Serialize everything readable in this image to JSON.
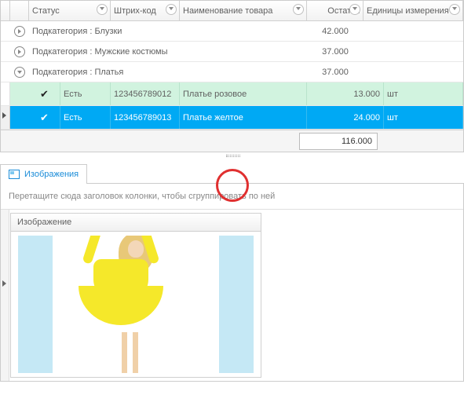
{
  "columns": {
    "status": "Статус",
    "barcode": "Штрих-код",
    "name": "Наименование товара",
    "rest": "Остаток",
    "unit": "Единицы измерения"
  },
  "groups": [
    {
      "label": "Подкатегория : Блузки",
      "rest": "42.000",
      "expanded": false
    },
    {
      "label": "Подкатегория : Мужские костюмы",
      "rest": "37.000",
      "expanded": false
    },
    {
      "label": "Подкатегория : Платья",
      "rest": "37.000",
      "expanded": true
    }
  ],
  "rows": [
    {
      "status": "Есть",
      "barcode": "123456789012",
      "name": "Платье розовое",
      "rest": "13.000",
      "unit": "шт",
      "selected": false
    },
    {
      "status": "Есть",
      "barcode": "123456789013",
      "name": "Платье желтое",
      "rest": "24.000",
      "unit": "шт",
      "selected": true
    }
  ],
  "total": "116.000",
  "tab": "Изображения",
  "group_hint": "Перетащите сюда заголовок колонки, чтобы сгруппировать по ней",
  "image_col": "Изображение"
}
